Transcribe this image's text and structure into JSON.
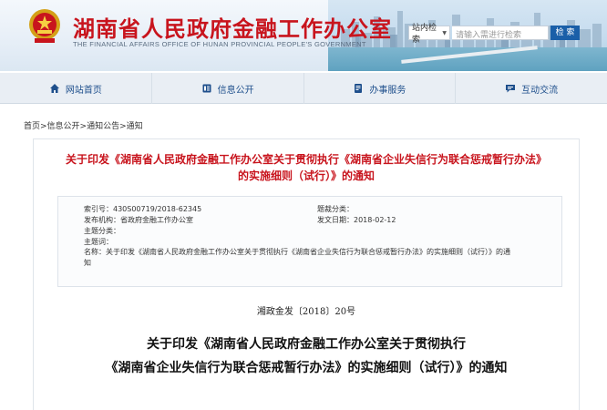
{
  "header": {
    "title_cn": "湖南省人民政府金融工作办公室",
    "title_en": "THE FINANCIAL AFFAIRS OFFICE OF HUNAN PROVINCIAL PEOPLE'S GOVERNMENT",
    "search": {
      "scope_label": "站内检索",
      "placeholder": "请输入需进行检索",
      "button_label": "检 索"
    }
  },
  "nav": {
    "items": [
      {
        "label": "网站首页",
        "icon": "home-icon"
      },
      {
        "label": "信息公开",
        "icon": "document-icon"
      },
      {
        "label": "办事服务",
        "icon": "service-icon"
      },
      {
        "label": "互动交流",
        "icon": "chat-icon"
      }
    ]
  },
  "breadcrumb": "首页>信息公开>通知公告>通知",
  "article": {
    "title_line1": "关于印发《湖南省人民政府金融工作办公室关于贯彻执行《湖南省企业失信行为联合惩戒暂行办法》",
    "title_line2": "的实施细则（试行）》的通知",
    "meta": {
      "index_no": "索引号：430S00719/2018-62345",
      "category": "题裁分类：",
      "issuer": "发布机构：省政府金融工作办公室",
      "issue_date": "发文日期：2018-02-12",
      "topic_category": "主题分类：",
      "topic_words": "主题词：",
      "name_line1": "名称：关于印发《湖南省人民政府金融工作办公室关于贯彻执行《湖南省企业失信行为联合惩戒暂行办法》的实施细则（试行）》的通",
      "name_line2": "知"
    },
    "doc_number": "湘政金发〔2018〕20号",
    "body_title_line1": "关于印发《湖南省人民政府金融工作办公室关于贯彻执行",
    "body_title_line2": "《湖南省企业失信行为联合惩戒暂行办法》的实施细则（试行）》的通知"
  },
  "colors": {
    "brand_red": "#c8141d",
    "nav_blue": "#1e4f8c",
    "search_button": "#1a5fa8"
  }
}
